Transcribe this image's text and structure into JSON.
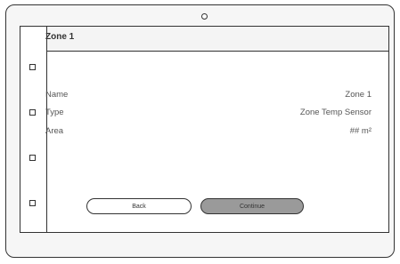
{
  "page": {
    "title": "Zone 1",
    "fields": [
      {
        "label": "Name",
        "value": "Zone 1"
      },
      {
        "label": "Type",
        "value": "Zone Temp Sensor"
      },
      {
        "label": "Area",
        "value": "## m²"
      }
    ]
  },
  "buttons": {
    "back": "Back",
    "continue": "Continue"
  },
  "sidebar": {
    "items": [
      "square-icon",
      "square-icon",
      "square-icon",
      "square-icon"
    ]
  }
}
